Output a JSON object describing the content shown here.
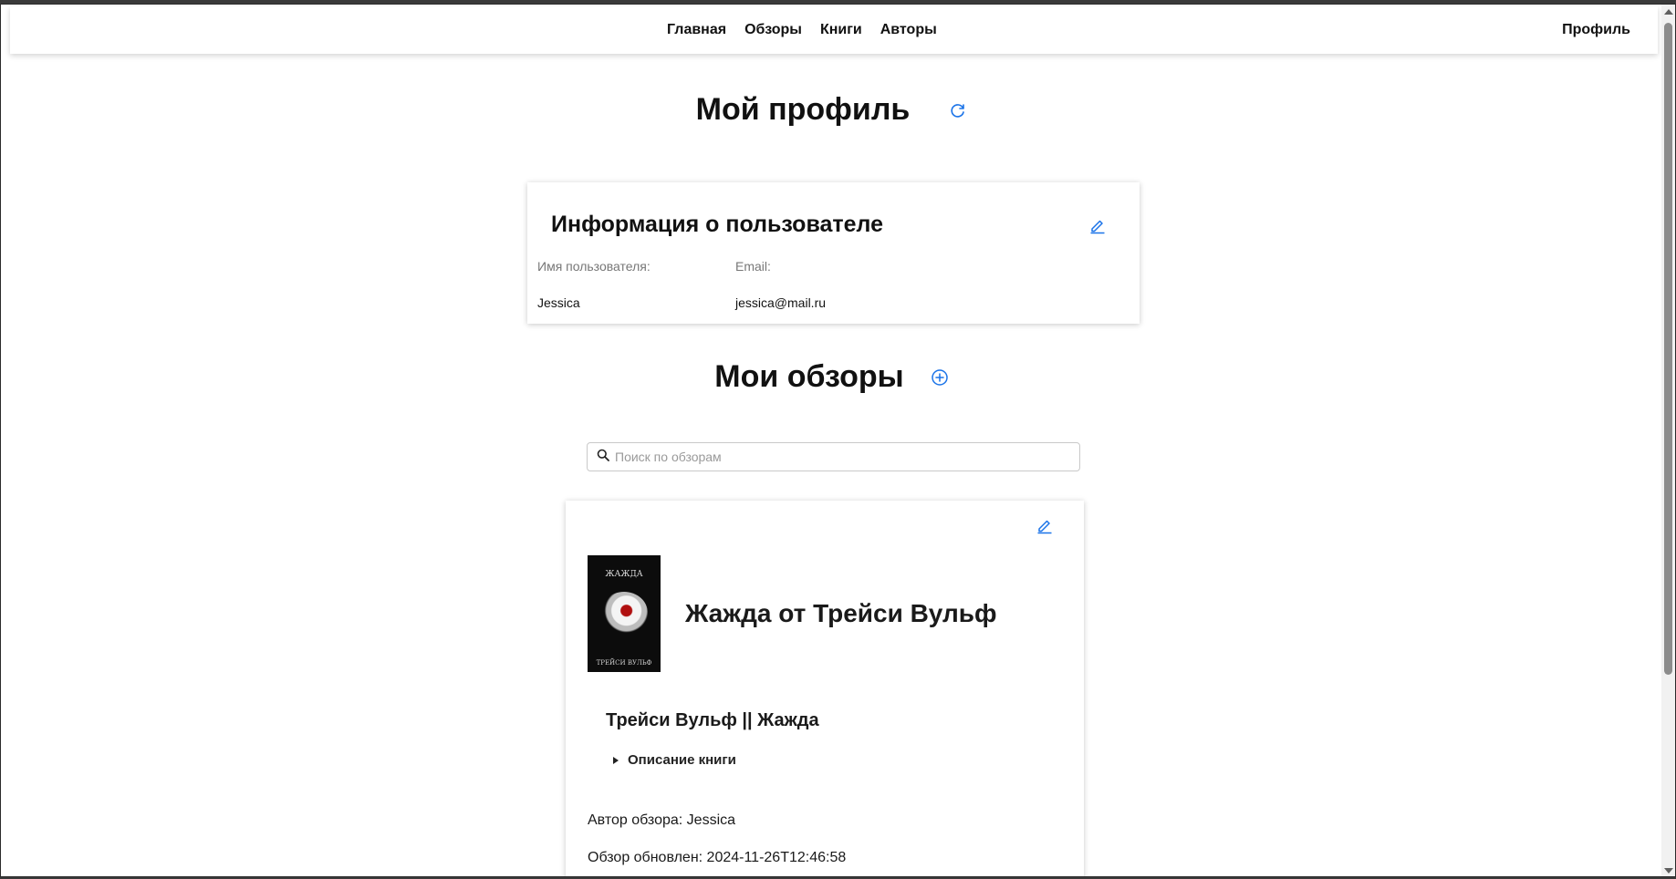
{
  "nav": {
    "items": [
      "Главная",
      "Обзоры",
      "Книги",
      "Авторы"
    ],
    "profile": "Профиль"
  },
  "profile_page": {
    "title": "Мой профиль",
    "refresh_icon": "refresh-icon"
  },
  "user_info": {
    "title": "Информация о пользователе",
    "username_label": "Имя пользователя:",
    "email_label": "Email:",
    "username": "Jessica",
    "email": "jessica@mail.ru"
  },
  "reviews": {
    "title": "Мои обзоры",
    "add_icon": "add-circle-icon",
    "search_placeholder": "Поиск по обзорам"
  },
  "review": {
    "cover_title": "ЖАЖДА",
    "cover_author": "ТРЕЙСИ ВУЛЬФ",
    "title": "Жажда от Трейси Вульф",
    "subtitle": "Трейси Вульф || Жажда",
    "details_label": "Описание книги",
    "author_line": "Автор обзора: Jessica",
    "updated_line": "Обзор обновлен: 2024-11-26T12:46:58"
  },
  "colors": {
    "accent": "#1a73e8",
    "background": "#ffffff"
  }
}
